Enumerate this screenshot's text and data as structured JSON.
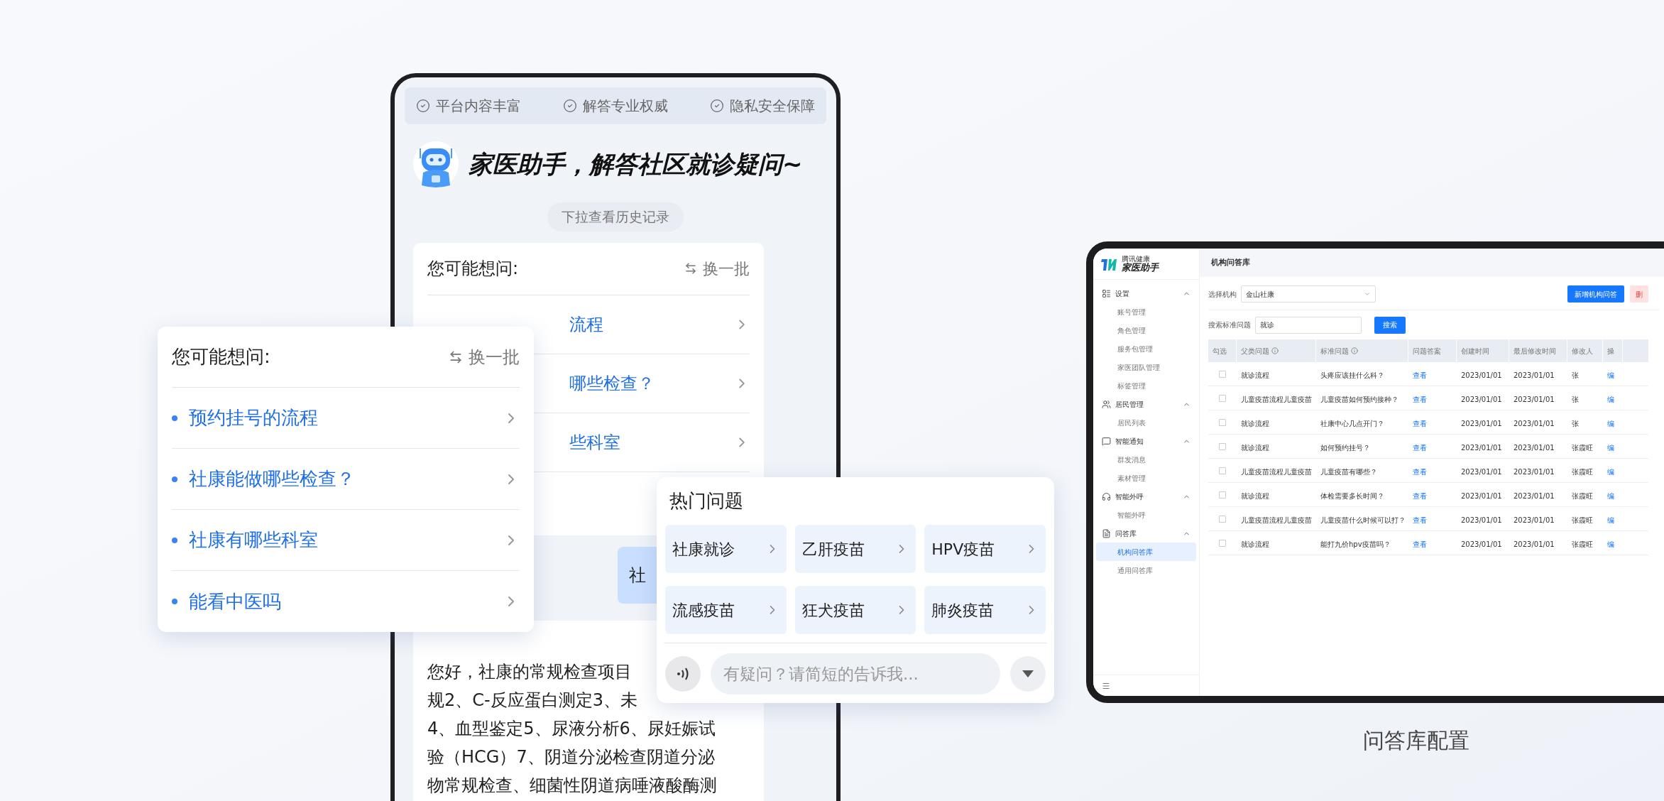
{
  "trust_badges": [
    {
      "label": "平台内容丰富"
    },
    {
      "label": "解答专业权威"
    },
    {
      "label": "隐私安全保障"
    }
  ],
  "assistant": {
    "title": "家医助手，解答社区就诊疑问~",
    "history_hint": "下拉查看历史记录"
  },
  "phone_suggestions": {
    "title": "您可能想问:",
    "refresh": "换一批",
    "items": [
      "流程",
      "哪些检查？",
      "些科室"
    ]
  },
  "user_message": "社",
  "answer_lines": [
    "您好，社康的常规检查项目",
    "规2、C-反应蛋白测定3、未",
    "4、血型鉴定5、尿液分析6、尿妊娠试",
    "验（HCG）7、阴道分泌检查阴道分泌",
    "物常规检查、细菌性阴道病唾液酸酶测"
  ],
  "suggestion_card": {
    "title": "您可能想问:",
    "refresh": "换一批",
    "items": [
      "预约挂号的流程",
      "社康能做哪些检查？",
      "社康有哪些科室",
      "能看中医吗"
    ]
  },
  "hot_questions": {
    "title": "热门问题",
    "items": [
      "社康就诊",
      "乙肝疫苗",
      "HPV疫苗",
      "流感疫苗",
      "狂犬疫苗",
      "肺炎疫苗"
    ],
    "placeholder": "有疑问？请简短的告诉我..."
  },
  "admin": {
    "brand_small": "腾讯健康",
    "brand": "家医助手",
    "page_title": "机构问答库",
    "sidebar": [
      {
        "label": "设置",
        "expanded": true,
        "children": [
          {
            "label": "账号管理",
            "selected": false
          },
          {
            "label": "角色管理",
            "selected": false
          },
          {
            "label": "服务包管理",
            "selected": false
          },
          {
            "label": "家医团队管理",
            "selected": false
          },
          {
            "label": "标签管理",
            "selected": false
          }
        ]
      },
      {
        "label": "居民管理",
        "expanded": true,
        "children": [
          {
            "label": "居民列表",
            "selected": false
          }
        ]
      },
      {
        "label": "智能通知",
        "expanded": true,
        "children": [
          {
            "label": "群发消息",
            "selected": false
          },
          {
            "label": "素材管理",
            "selected": false
          }
        ]
      },
      {
        "label": "智能外呼",
        "expanded": true,
        "children": [
          {
            "label": "智能外呼",
            "selected": false
          }
        ]
      },
      {
        "label": "问答库",
        "expanded": true,
        "children": [
          {
            "label": "机构问答库",
            "selected": true
          },
          {
            "label": "通用问答库",
            "selected": false
          }
        ]
      }
    ],
    "org_label": "选择机构",
    "org_value": "金山社康",
    "add_button": "新增机构问答",
    "delete_button": "删",
    "search_label": "搜索标准问题",
    "search_value": "就诊",
    "search_button": "搜索",
    "columns": [
      {
        "label": "勾选",
        "info": false
      },
      {
        "label": "父类问题",
        "info": true
      },
      {
        "label": "标准问题",
        "info": true
      },
      {
        "label": "问题答案",
        "info": false
      },
      {
        "label": "创建时间",
        "info": false
      },
      {
        "label": "最后修改时间",
        "info": false
      },
      {
        "label": "修改人",
        "info": false
      },
      {
        "label": "操",
        "info": false
      }
    ],
    "rows": [
      {
        "checked": false,
        "parent": "就诊流程",
        "question": "头疼应该挂什么科？",
        "answer": "查看",
        "created": "2023/01/01",
        "modified": "2023/01/01",
        "editor": "张",
        "action": "编"
      },
      {
        "checked": false,
        "parent": "儿童疫苗流程儿童疫苗",
        "question": "儿童疫苗如何预约接种？",
        "answer": "查看",
        "created": "2023/01/01",
        "modified": "2023/01/01",
        "editor": "张",
        "action": "编"
      },
      {
        "checked": false,
        "parent": "就诊流程",
        "question": "社康中心几点开门？",
        "answer": "查看",
        "created": "2023/01/01",
        "modified": "2023/01/01",
        "editor": "张",
        "action": "编"
      },
      {
        "checked": false,
        "parent": "就诊流程",
        "question": "如何预约挂号？",
        "answer": "查看",
        "created": "2023/01/01",
        "modified": "2023/01/01",
        "editor": "张霞旺",
        "action": "编"
      },
      {
        "checked": false,
        "parent": "儿童疫苗流程儿童疫苗",
        "question": "儿童疫苗有哪些？",
        "answer": "查看",
        "created": "2023/01/01",
        "modified": "2023/01/01",
        "editor": "张霞旺",
        "action": "编"
      },
      {
        "checked": false,
        "parent": "就诊流程",
        "question": "体检需要多长时间？",
        "answer": "查看",
        "created": "2023/01/01",
        "modified": "2023/01/01",
        "editor": "张霞旺",
        "action": "编"
      },
      {
        "checked": false,
        "parent": "儿童疫苗流程儿童疫苗",
        "question": "儿童疫苗什么时候可以打？",
        "answer": "查看",
        "created": "2023/01/01",
        "modified": "2023/01/01",
        "editor": "张霞旺",
        "action": "编"
      },
      {
        "checked": false,
        "parent": "就诊流程",
        "question": "能打九价hpv疫苗吗？",
        "answer": "查看",
        "created": "2023/01/01",
        "modified": "2023/01/01",
        "editor": "张霞旺",
        "action": "编"
      }
    ]
  },
  "caption": "问答库配置"
}
